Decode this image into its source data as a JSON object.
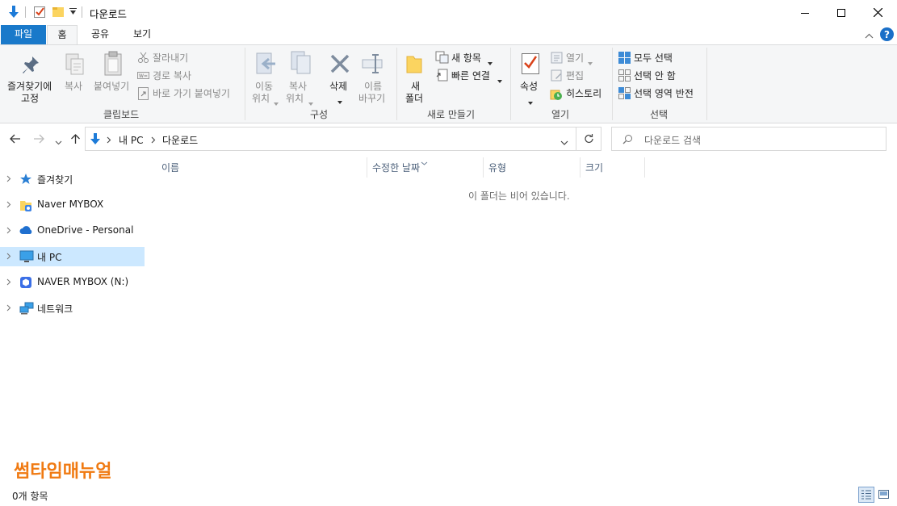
{
  "window": {
    "title": "다운로드"
  },
  "tabs": {
    "file": "파일",
    "home": "홈",
    "share": "공유",
    "view": "보기"
  },
  "ribbon": {
    "clipboard": {
      "pin_label_1": "즐겨찾기에",
      "pin_label_2": "고정",
      "copy": "복사",
      "paste": "붙여넣기",
      "cut": "잘라내기",
      "copy_path": "경로 복사",
      "paste_shortcut": "바로 가기 붙여넣기",
      "group": "클립보드"
    },
    "organize": {
      "move_1": "이동",
      "move_2": "위치",
      "copyto_1": "복사",
      "copyto_2": "위치",
      "delete": "삭제",
      "rename_1": "이름",
      "rename_2": "바꾸기",
      "group": "구성"
    },
    "new": {
      "folder_1": "새",
      "folder_2": "폴더",
      "new_item": "새 항목",
      "easy_access": "빠른 연결",
      "group": "새로 만들기"
    },
    "open": {
      "properties": "속성",
      "open": "열기",
      "edit": "편집",
      "history": "히스토리",
      "group": "열기"
    },
    "select": {
      "select_all": "모두 선택",
      "select_none": "선택 안 함",
      "invert": "선택 영역 반전",
      "group": "선택"
    }
  },
  "address": {
    "crumbs": [
      "내 PC",
      "다운로드"
    ],
    "search_placeholder": "다운로드 검색"
  },
  "nav_pane": {
    "items": [
      {
        "label": "즐겨찾기",
        "icon": "star-icon"
      },
      {
        "label": "Naver MYBOX",
        "icon": "mybox-folder-icon"
      },
      {
        "label": "OneDrive - Personal",
        "icon": "cloud-icon"
      },
      {
        "label": "내 PC",
        "icon": "computer-icon",
        "selected": true
      },
      {
        "label": "NAVER MYBOX (N:)",
        "icon": "mybox-drive-icon"
      },
      {
        "label": "네트워크",
        "icon": "network-icon"
      }
    ]
  },
  "columns": [
    "이름",
    "수정한 날짜",
    "유형",
    "크기"
  ],
  "empty_message": "이 폴더는 비어 있습니다.",
  "watermark": "썸타임매뉴얼",
  "status": {
    "item_count": "0개 항목"
  },
  "colors": {
    "accent": "#1979ca",
    "selected_bg": "#cce8ff",
    "watermark": "#f07a12"
  }
}
